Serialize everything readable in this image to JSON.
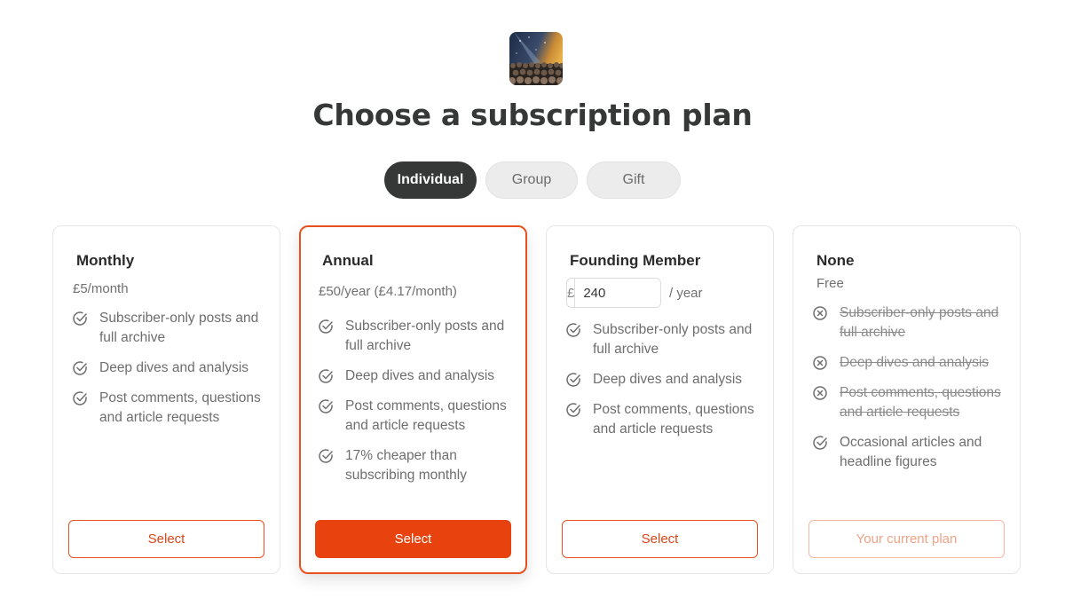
{
  "page": {
    "title": "Choose a subscription plan"
  },
  "tabs": [
    {
      "label": "Individual",
      "active": true
    },
    {
      "label": "Group",
      "active": false
    },
    {
      "label": "Gift",
      "active": false
    }
  ],
  "plans": [
    {
      "name": "Monthly",
      "price": "£5/month",
      "features": [
        {
          "text": "Subscriber-only posts and full archive",
          "icon": "check-circle-icon"
        },
        {
          "text": "Deep dives and analysis",
          "icon": "check-circle-icon"
        },
        {
          "text": "Post comments, questions and article requests",
          "icon": "check-circle-icon"
        }
      ],
      "button": "Select"
    },
    {
      "name": "Annual",
      "price": "£50/year (£4.17/month)",
      "features": [
        {
          "text": "Subscriber-only posts and full archive",
          "icon": "check-circle-icon"
        },
        {
          "text": "Deep dives and analysis",
          "icon": "check-circle-icon"
        },
        {
          "text": "Post comments, questions and article requests",
          "icon": "check-circle-icon"
        },
        {
          "text": "17% cheaper than subscribing monthly",
          "icon": "check-circle-icon"
        }
      ],
      "button": "Select"
    },
    {
      "name": "Founding Member",
      "currency": "£",
      "amount": "240",
      "per": "/ year",
      "features": [
        {
          "text": "Subscriber-only posts and full archive",
          "icon": "check-circle-icon"
        },
        {
          "text": "Deep dives and analysis",
          "icon": "check-circle-icon"
        },
        {
          "text": "Post comments, questions and article requests",
          "icon": "check-circle-icon"
        }
      ],
      "button": "Select"
    },
    {
      "name": "None",
      "price": "Free",
      "features": [
        {
          "text": "Subscriber-only posts and full archive",
          "icon": "x-circle-icon"
        },
        {
          "text": "Deep dives and analysis",
          "icon": "x-circle-icon"
        },
        {
          "text": "Post comments, questions and article requests",
          "icon": "x-circle-icon"
        },
        {
          "text": "Occasional articles and headline figures",
          "icon": "check-circle-icon"
        }
      ],
      "button": "Your current plan"
    }
  ],
  "colors": {
    "accent": "#e8430f",
    "text": "#363737",
    "muted_text": "#6e6e6e"
  }
}
